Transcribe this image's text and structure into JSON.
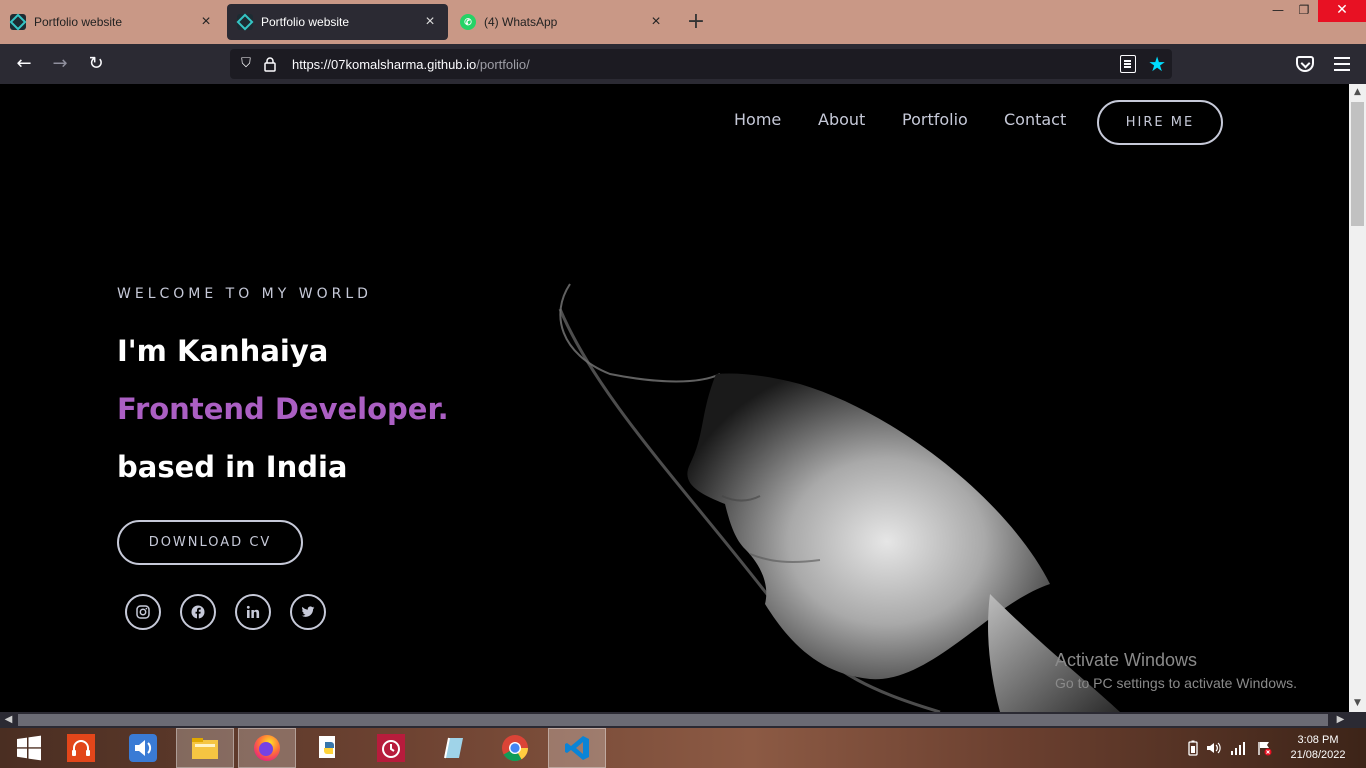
{
  "browser": {
    "tabs": [
      {
        "title": "Portfolio website",
        "active": false,
        "icon": "portfolio-favicon"
      },
      {
        "title": "Portfolio website",
        "active": true,
        "icon": "portfolio-favicon"
      },
      {
        "title": "(4) WhatsApp",
        "active": false,
        "icon": "whatsapp-favicon"
      }
    ],
    "url_main": "https://07komalsharma.github.io",
    "url_path": "/portfolio/"
  },
  "site": {
    "nav": [
      "Home",
      "About",
      "Portfolio",
      "Contact"
    ],
    "hire_label": "HIRE ME",
    "welcome": "WELCOME TO MY WORLD",
    "line1": "I'm Kanhaiya",
    "line2": "Frontend Developer.",
    "line3": "based in India",
    "cv_label": "DOWNLOAD CV",
    "socials": [
      "instagram-icon",
      "facebook-icon",
      "linkedin-icon",
      "twitter-icon"
    ],
    "accent_color": "#ab5fc3"
  },
  "watermark": {
    "title": "Activate Windows",
    "subtitle": "Go to PC settings to activate Windows."
  },
  "taskbar": {
    "time": "3:08 PM",
    "date": "21/08/2022",
    "apps": [
      "windows-start-icon",
      "music-app-icon",
      "volume-app-icon",
      "file-explorer-icon",
      "firefox-icon",
      "python-icon",
      "alarm-clock-icon",
      "notes-app-icon",
      "chrome-icon",
      "vscode-icon"
    ]
  }
}
